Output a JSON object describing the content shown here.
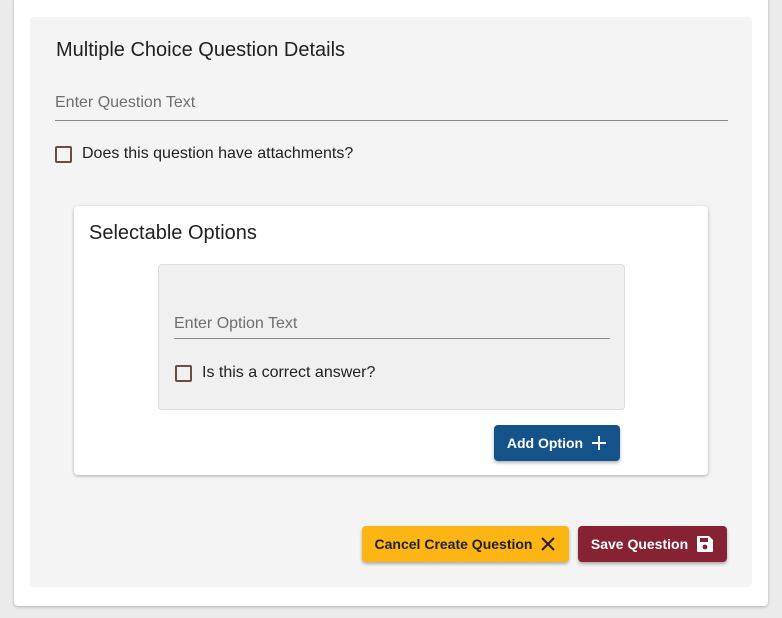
{
  "details": {
    "title": "Multiple Choice Question Details",
    "question_placeholder": "Enter Question Text",
    "question_value": "",
    "attachments_label": "Does this question have attachments?",
    "attachments_checked": false
  },
  "options": {
    "title": "Selectable Options",
    "items": [
      {
        "placeholder": "Enter Option Text",
        "value": "",
        "correct_label": "Is this a correct answer?",
        "correct_checked": false
      }
    ],
    "add_label": "Add Option",
    "add_icon": "plus-icon"
  },
  "actions": {
    "cancel_label": "Cancel Create Question",
    "cancel_icon": "close-icon",
    "save_label": "Save Question",
    "save_icon": "floppy-disk-icon"
  },
  "colors": {
    "primary_blue": "#14528a",
    "cancel_gold": "#fdb515",
    "save_maroon": "#862234",
    "checkbox_border": "#6d4c41"
  }
}
